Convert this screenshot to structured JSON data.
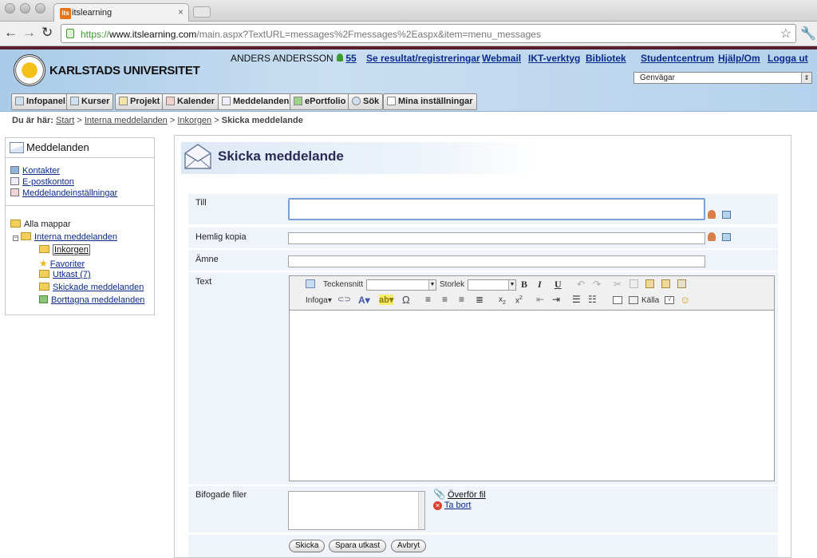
{
  "browser": {
    "tab_title": "itslearning",
    "tab_favicon": "its",
    "url_scheme": "https://",
    "url_host": "www.itslearning.com",
    "url_path": "/main.aspx?TextURL=messages%2Fmessages%2Easpx&item=menu_messages"
  },
  "header": {
    "university": "KARLSTADS UNIVERSITET",
    "user_name": "ANDERS ANDERSSON",
    "online_count": "55",
    "links": [
      "Se resultat/registreringar",
      "Webmail",
      "IKT-verktyg",
      "Bibliotek",
      "Studentcentrum",
      "Hjälp/Om",
      "Logga ut"
    ],
    "shortcuts_select": "Genvägar",
    "tabs": [
      "Infopanel",
      "Kurser",
      "Projekt",
      "Kalender",
      "Meddelanden",
      "ePortfolio",
      "Sök",
      "Mina inställningar"
    ]
  },
  "breadcrumb": {
    "prefix": "Du är här:",
    "items": [
      "Start",
      "Interna meddelanden",
      "Inkorgen"
    ],
    "current": "Skicka meddelande",
    "sep": ">"
  },
  "sidebar": {
    "title": "Meddelanden",
    "links": [
      "Kontakter",
      "E-postkonton",
      "Meddelandeinställningar"
    ],
    "all_folders": "Alla mappar",
    "internal": "Interna meddelanden",
    "folders": [
      "Inkorgen",
      "Favoriter",
      "Utkast (7)",
      "Skickade meddelanden",
      "Borttagna meddelanden"
    ]
  },
  "form": {
    "title": "Skicka meddelande",
    "to_label": "Till",
    "bcc_label": "Hemlig kopia",
    "subject_label": "Ämne",
    "text_label": "Text",
    "attachments_label": "Bifogade filer",
    "upload_link": "Överför fil",
    "remove_link": "Ta bort",
    "editor": {
      "font_label": "Teckensnitt",
      "size_label": "Storlek",
      "insert_label": "Infoga",
      "source_label": "Källa"
    },
    "buttons": {
      "send": "Skicka",
      "save_draft": "Spara utkast",
      "cancel": "Avbryt"
    }
  }
}
